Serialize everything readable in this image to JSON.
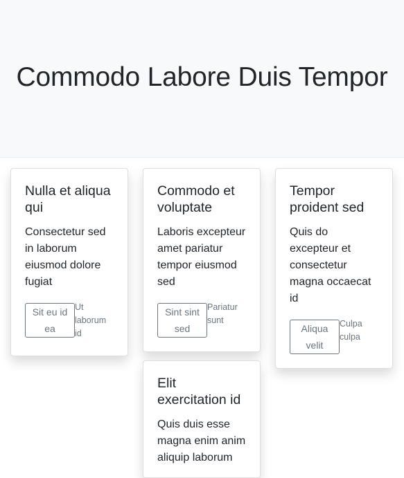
{
  "hero": {
    "title": "Commodo Labore Duis Tempor"
  },
  "cards": [
    {
      "title": "Nulla et aliqua qui",
      "text": "Consectetur sed in laborum eiusmod dolore fugiat",
      "button": "Sit eu id ea",
      "link": "Ut laborum id"
    },
    {
      "title": "Commodo et voluptate",
      "text": "Laboris excepteur amet pariatur tempor eiusmod sed",
      "button": "Sint sint sed",
      "link": "Pariatur sunt"
    },
    {
      "title": "Tempor proident sed",
      "text": "Quis do excepteur et consectetur magna occaecat id",
      "button": "Aliqua velit",
      "link": "Culpa culpa"
    },
    {
      "title": "Elit exercitation id",
      "text": "Quis duis esse magna enim anim aliquip laborum"
    }
  ]
}
